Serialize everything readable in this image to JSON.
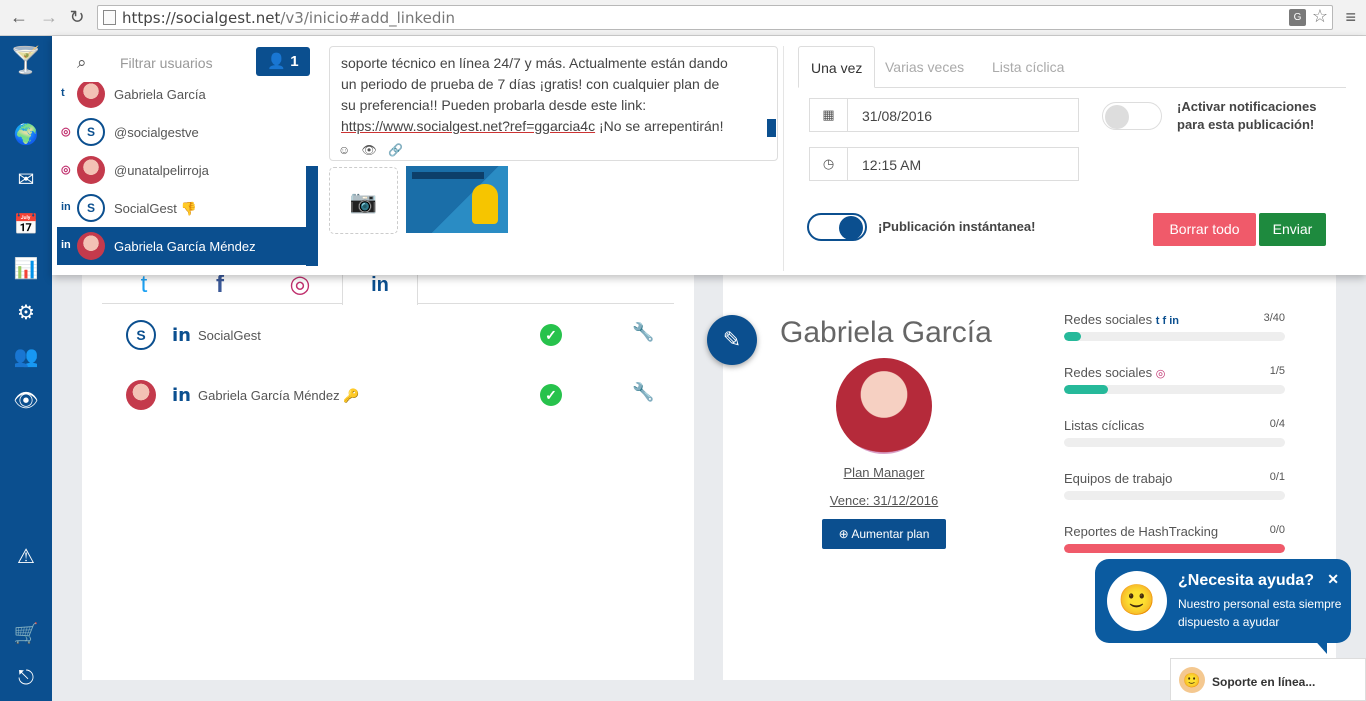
{
  "browser": {
    "url_domain": "https://socialgest.net",
    "url_path": "/v3/inicio#add_linkedin",
    "translate_glyph": "G"
  },
  "icons": {
    "back": "←",
    "forward": "→",
    "reload": "↻",
    "star": "☆",
    "menu": "≡",
    "search": "⌕",
    "user": "👤",
    "calendar": "▦",
    "clock": "◷",
    "camera": "📷",
    "emoji": "☺",
    "eye": "👁",
    "link": "🔗",
    "check": "✓",
    "wrench": "🔧",
    "edit": "✎",
    "close": "✕",
    "upgrade": "⊕",
    "key": "🔑",
    "thumb": "👎",
    "linkedin": "in",
    "instagram": "◎",
    "twitter": "t"
  },
  "sidebar": {
    "items": [
      "🍸",
      "🌍",
      "✉",
      "📅",
      "📊",
      "⚙",
      "👥",
      "👁",
      "⚠",
      "🛒",
      "⎋"
    ]
  },
  "users_panel": {
    "filter_placeholder": "Filtrar usuarios",
    "count": "1",
    "items": [
      {
        "network": "t",
        "name": "Gabriela García",
        "selected": false
      },
      {
        "network": "◎",
        "name": "@socialgestve",
        "selected": false
      },
      {
        "network": "◎",
        "name": "@unatalpelirroja",
        "selected": false
      },
      {
        "network": "in",
        "name": "SocialGest",
        "selected": false
      },
      {
        "network": "in",
        "name": "Gabriela García Méndez",
        "selected": true
      }
    ]
  },
  "composer": {
    "text_line1": "soporte técnico en línea 24/7 y más. Actualmente están dando",
    "text_line2": "un periodo de prueba de 7 días ¡gratis! con cualquier plan de",
    "text_line3": "su preferencia!! Pueden probarla desde este link:",
    "link_text": "https://www.socialgest.net?ref=ggarcia4c",
    "text_tail": " ¡No se arrepentirán!"
  },
  "schedule": {
    "tabs": [
      "Una vez",
      "Varias veces",
      "Lista cíclica"
    ],
    "date": "31/08/2016",
    "time": "12:15 AM",
    "notify_label": "¡Activar notificaciones para esta publicación!",
    "instant_label": "¡Publicación instántanea!",
    "clear_label": "Borrar todo",
    "send_label": "Enviar"
  },
  "accounts": [
    {
      "name": "SocialGest",
      "network": "in"
    },
    {
      "name": "Gabriela García Méndez",
      "network": "in"
    }
  ],
  "profile": {
    "name": "Gabriela García",
    "plan": "Plan Manager",
    "expires": "Vence: 31/12/2016",
    "upgrade_label": "Aumentar plan",
    "stats": [
      {
        "label": "Redes sociales",
        "icons": "t f in",
        "value": "3/40",
        "fraction": 0.075,
        "color": "#26b99a"
      },
      {
        "label": "Redes sociales",
        "icons": "◎",
        "value": "1/5",
        "fraction": 0.2,
        "color": "#26b99a"
      },
      {
        "label": "Listas cíclicas",
        "icons": "",
        "value": "0/4",
        "fraction": 0,
        "color": "#26b99a"
      },
      {
        "label": "Equipos de trabajo",
        "icons": "",
        "value": "0/1",
        "fraction": 0,
        "color": "#26b99a"
      },
      {
        "label": "Reportes de HashTracking",
        "icons": "",
        "value": "0/0",
        "fraction": 1,
        "color": "#f05a6a"
      }
    ]
  },
  "help": {
    "title": "¿Necesita ayuda?",
    "text": "Nuestro personal esta siempre dispuesto a ayudar",
    "support": "Soporte en línea..."
  },
  "colors": {
    "brand": "#0b4f8f",
    "success": "#27c24c",
    "danger": "#f05a6a",
    "send": "#1e8a3e"
  }
}
